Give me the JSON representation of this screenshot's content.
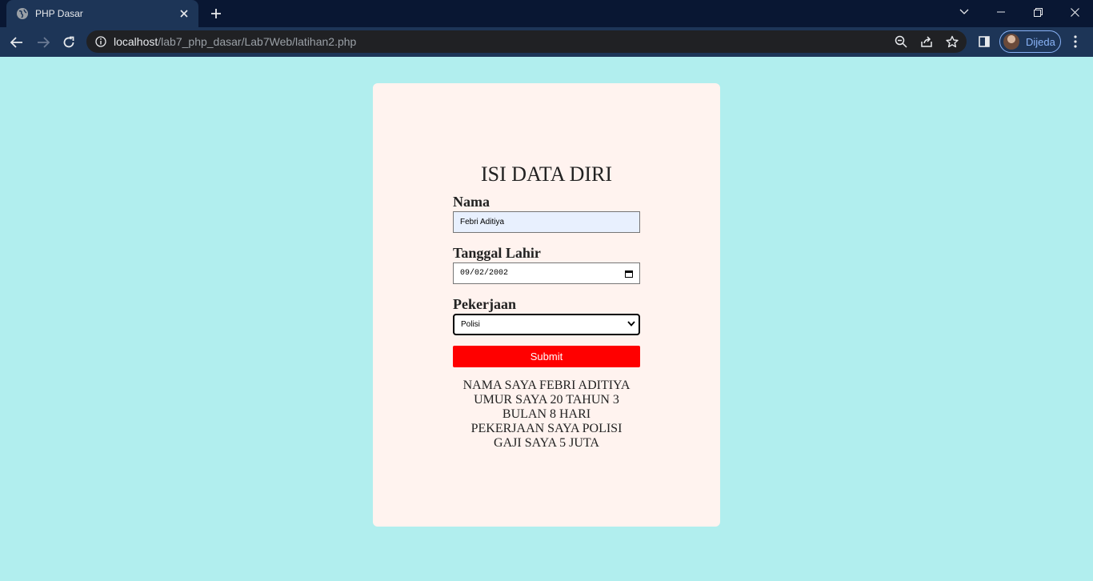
{
  "browser": {
    "tab_title": "PHP Dasar",
    "url_host": "localhost",
    "url_path": "/lab7_php_dasar/Lab7Web/latihan2.php",
    "profile_name": "Dijeda"
  },
  "colors": {
    "page_background": "#b1eeee",
    "card_background": "#fff3ef",
    "submit_background": "#ff0000",
    "browser_frame": "#1d3557"
  },
  "form": {
    "title": "ISI DATA DIRI",
    "nama_label": "Nama",
    "nama_value": "Febri Aditiya",
    "tanggal_label": "Tanggal Lahir",
    "tanggal_value": "09/02/2002",
    "pekerjaan_label": "Pekerjaan",
    "pekerjaan_value": "Polisi",
    "submit_label": "Submit"
  },
  "result": {
    "line1": "NAMA SAYA FEBRI ADITIYA",
    "line2": "UMUR SAYA 20 TAHUN 3",
    "line3": "BULAN 8 HARI",
    "line4": "PEKERJAAN SAYA POLISI",
    "line5": "GAJI SAYA 5 JUTA"
  }
}
